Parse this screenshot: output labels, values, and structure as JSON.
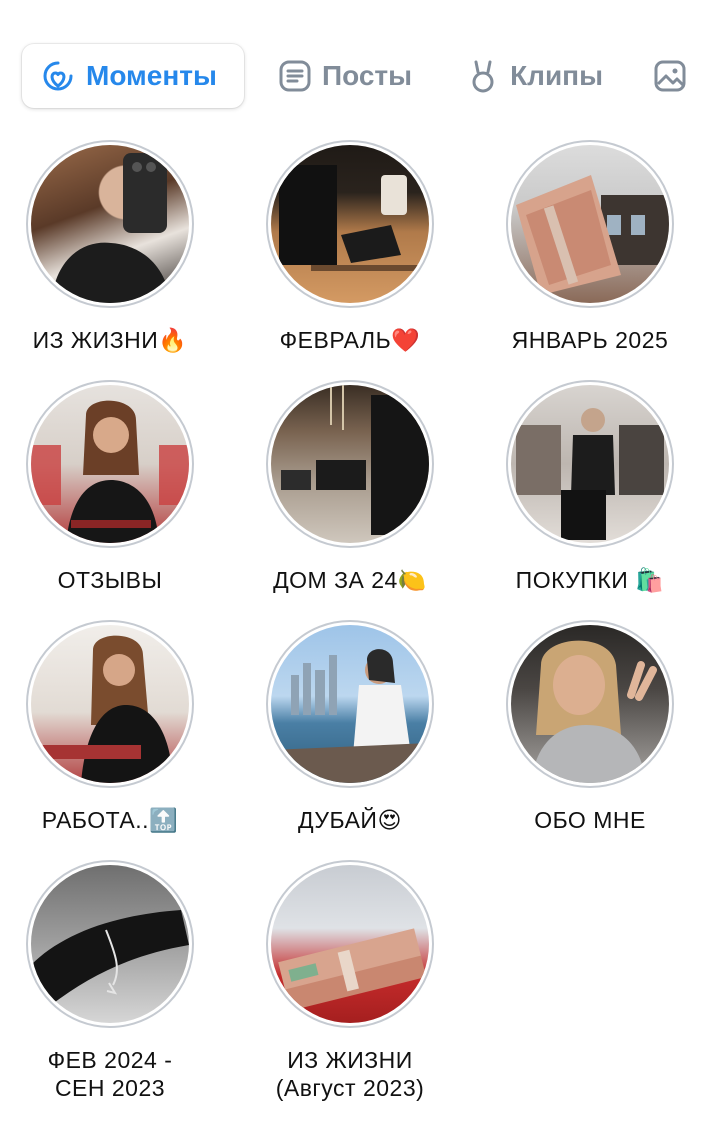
{
  "tabs": [
    {
      "label": "Моменты",
      "icon": "heart-circle-icon",
      "active": true
    },
    {
      "label": "Посты",
      "icon": "posts-icon",
      "active": false
    },
    {
      "label": "Клипы",
      "icon": "clips-icon",
      "active": false
    },
    {
      "label": "",
      "icon": "photo-icon",
      "active": false
    }
  ],
  "colors": {
    "accent": "#2688eb",
    "inactive": "#818c99",
    "ring": "#c5cad1"
  },
  "stories": [
    {
      "title": "ИЗ ЖИЗНИ",
      "emoji": "🔥"
    },
    {
      "title": "ФЕВРАЛЬ",
      "emoji": "❤️"
    },
    {
      "title": "ЯНВАРЬ 2025",
      "emoji": ""
    },
    {
      "title": "ОТЗЫВЫ",
      "emoji": ""
    },
    {
      "title": "ДОМ ЗА 24",
      "emoji": "🍋"
    },
    {
      "title": "ПОКУПКИ ",
      "emoji": "🛍️"
    },
    {
      "title": "РАБОТА..",
      "emoji": "🔝"
    },
    {
      "title": "ДУБАЙ",
      "emoji": "😍"
    },
    {
      "title": "ОБО МНЕ",
      "emoji": ""
    },
    {
      "title": "ФЕВ 2024 -",
      "title2": "СЕН 2023",
      "emoji": ""
    },
    {
      "title": "ИЗ ЖИЗНИ",
      "title2": "(Август 2023)",
      "emoji": ""
    }
  ]
}
